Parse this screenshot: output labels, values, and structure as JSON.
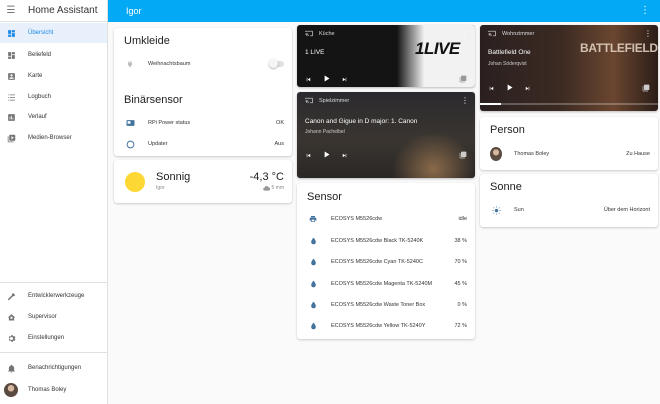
{
  "app": {
    "title": "Home Assistant"
  },
  "sidebar": {
    "items": [
      {
        "label": "Übersicht",
        "icon": "dashboard-icon",
        "active": true
      },
      {
        "label": "Beliefeld",
        "icon": "dashboard-icon",
        "active": false
      },
      {
        "label": "Karte",
        "icon": "account-box-icon",
        "active": false
      },
      {
        "label": "Logbuch",
        "icon": "list-icon",
        "active": false
      },
      {
        "label": "Verlauf",
        "icon": "chart-box-icon",
        "active": false
      },
      {
        "label": "Medien-Browser",
        "icon": "media-library-icon",
        "active": false
      }
    ],
    "bottom_items": [
      {
        "label": "Entwicklerwerkzeuge",
        "icon": "hammer-icon"
      },
      {
        "label": "Supervisor",
        "icon": "home-gear-icon"
      },
      {
        "label": "Einstellungen",
        "icon": "gear-icon"
      }
    ],
    "notifications": "Benachrichtigungen",
    "user": "Thomas Boley"
  },
  "header": {
    "title": "Igor"
  },
  "umkleide": {
    "title": "Umkleide",
    "entities": [
      {
        "name": "Weihnachtsbaum",
        "icon": "power-plug-icon",
        "state": "off"
      }
    ]
  },
  "binaersensor": {
    "title": "Binärsensor",
    "entities": [
      {
        "name": "RPi Power status",
        "icon": "raspberry-icon",
        "state": "OK"
      },
      {
        "name": "Updater",
        "icon": "circle-outline-icon",
        "state": "Aus"
      }
    ]
  },
  "weather": {
    "condition": "Sonnig",
    "location": "Igor",
    "temperature": "-4,3 °C",
    "wind": "5 mm",
    "icon": "sun-icon"
  },
  "media": [
    {
      "source": "Küche",
      "title": "1 LIVE",
      "subtitle": "",
      "art_text": "1LIVE",
      "progress": 0
    },
    {
      "source": "Spielzimmer",
      "title": "Canon and Gigue in D major: 1. Canon",
      "subtitle": "Johann Pachelbel",
      "art_text": "",
      "progress": 0
    },
    {
      "source": "Wohnzimmer",
      "title": "Battlefield One",
      "subtitle": "Johan Söderqvist",
      "art_text": "BATTLEFIELD 1",
      "progress": 0.12
    }
  ],
  "sensor": {
    "title": "Sensor",
    "entities": [
      {
        "name": "ECOSYS M5526cdw",
        "icon": "printer-icon",
        "state": "idle"
      },
      {
        "name": "ECOSYS M5526cdw Black TK-5240K",
        "icon": "water-drop-icon",
        "state": "38 %"
      },
      {
        "name": "ECOSYS M5526cdw Cyan TK-5240C",
        "icon": "water-drop-icon",
        "state": "70 %"
      },
      {
        "name": "ECOSYS M5526cdw Magenta TK-5240M",
        "icon": "water-drop-icon",
        "state": "45 %"
      },
      {
        "name": "ECOSYS M5526cdw Waste Toner Box",
        "icon": "water-drop-icon",
        "state": "0 %"
      },
      {
        "name": "ECOSYS M5526cdw Yellow TK-5240Y",
        "icon": "water-drop-icon",
        "state": "72 %"
      }
    ]
  },
  "person": {
    "title": "Person",
    "entities": [
      {
        "name": "Thomas Boley",
        "state": "Zu Hause"
      }
    ]
  },
  "sonne": {
    "title": "Sonne",
    "entities": [
      {
        "name": "Sun",
        "icon": "sun-icon",
        "state": "Über dem Horizont"
      }
    ]
  }
}
